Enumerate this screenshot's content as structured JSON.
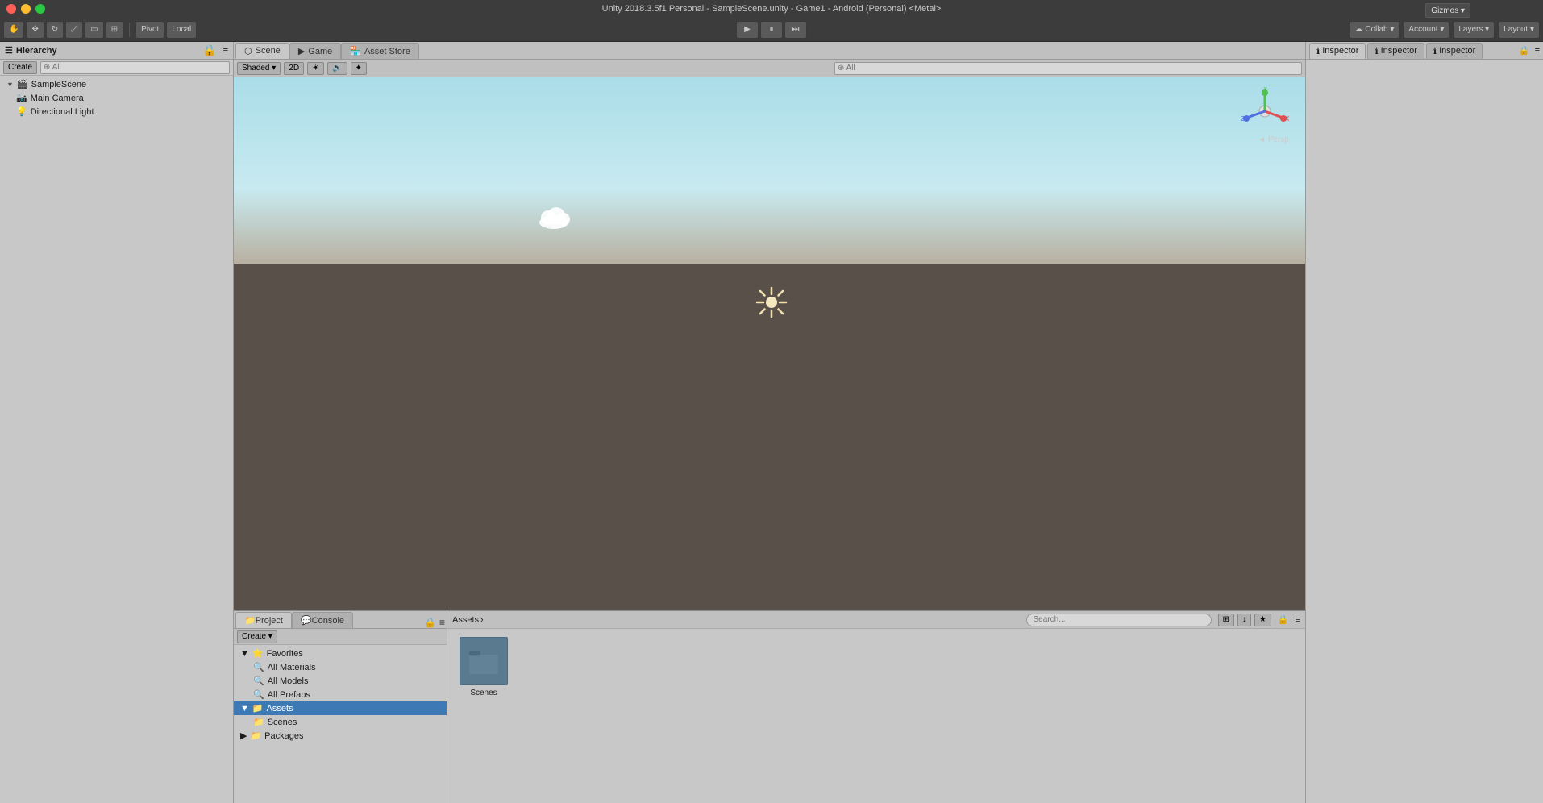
{
  "titleBar": {
    "title": "Unity 2018.3.5f1 Personal - SampleScene.unity - Game1 - Android (Personal) <Metal>"
  },
  "toolbar": {
    "pivot_label": "Pivot",
    "local_label": "Local",
    "collab_label": "Collab ▾",
    "account_label": "Account ▾",
    "layers_label": "Layers ▾",
    "layout_label": "Layout ▾",
    "play_icon": "▶",
    "pause_icon": "⏸",
    "step_icon": "⏭"
  },
  "hierarchy": {
    "panel_title": "Hierarchy",
    "create_label": "Create",
    "search_placeholder": "⊕ All",
    "items": [
      {
        "name": "SampleScene",
        "type": "scene",
        "indent": 0
      },
      {
        "name": "Main Camera",
        "type": "camera",
        "indent": 1
      },
      {
        "name": "Directional Light",
        "type": "light",
        "indent": 1
      }
    ]
  },
  "sceneView": {
    "tabs": [
      {
        "name": "Scene",
        "active": true
      },
      {
        "name": "Game",
        "active": false
      },
      {
        "name": "Asset Store",
        "active": false
      }
    ],
    "shading_mode": "Shaded",
    "mode_2d": "2D",
    "gizmos_label": "Gizmos",
    "persp_label": "◄ Persp"
  },
  "inspector": {
    "tabs": [
      {
        "name": "Inspector",
        "active": true
      },
      {
        "name": "Inspector",
        "active": false
      },
      {
        "name": "Inspector",
        "active": false
      }
    ]
  },
  "project": {
    "tabs": [
      {
        "name": "Project",
        "active": true
      },
      {
        "name": "Console",
        "active": false
      }
    ],
    "create_label": "Create",
    "tree": [
      {
        "name": "Favorites",
        "type": "favorites",
        "indent": 0,
        "expanded": true
      },
      {
        "name": "All Materials",
        "type": "search",
        "indent": 1
      },
      {
        "name": "All Models",
        "type": "search",
        "indent": 1
      },
      {
        "name": "All Prefabs",
        "type": "search",
        "indent": 1
      },
      {
        "name": "Assets",
        "type": "folder",
        "indent": 0,
        "expanded": true,
        "selected": true
      },
      {
        "name": "Scenes",
        "type": "folder",
        "indent": 1
      },
      {
        "name": "Packages",
        "type": "folder",
        "indent": 0
      }
    ]
  },
  "assets": {
    "breadcrumb": "Assets",
    "items": [
      {
        "name": "Scenes",
        "type": "folder"
      }
    ]
  },
  "colors": {
    "accent": "#3d7ab5",
    "toolbar_bg": "#3c3c3c",
    "panel_bg": "#c8c8c8",
    "scene_sky": "#aadde8",
    "scene_ground": "#6b6055"
  }
}
